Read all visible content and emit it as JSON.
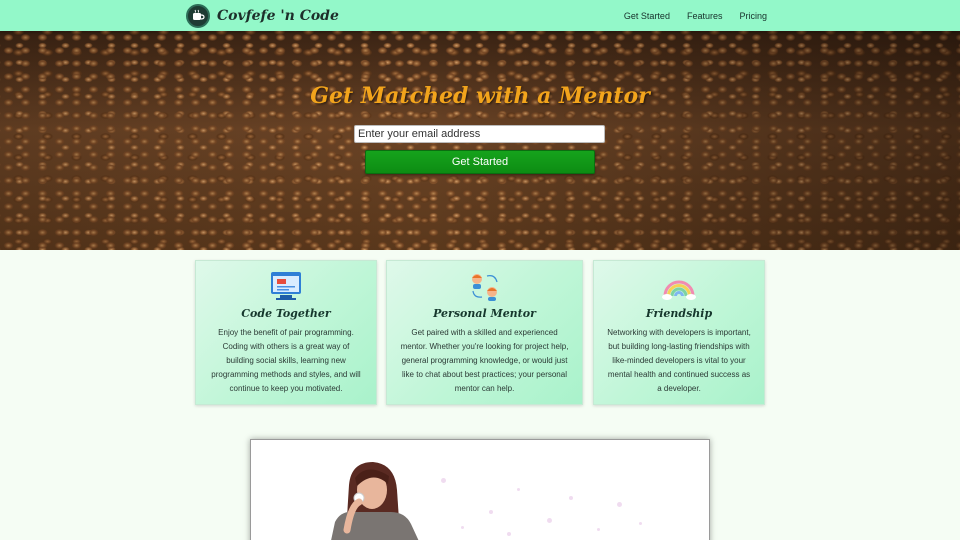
{
  "nav": {
    "brand": {
      "name": "Covfefe 'n Code",
      "logo_icon": "coffee-cup-logo-icon"
    },
    "links": [
      {
        "label": "Get Started"
      },
      {
        "label": "Features"
      },
      {
        "label": "Pricing"
      }
    ]
  },
  "hero": {
    "title": "Get Matched with a Mentor",
    "email_placeholder": "Enter your email address",
    "cta_label": "Get Started"
  },
  "features": [
    {
      "icon": "code-window-icon",
      "title": "Code Together",
      "text": "Enjoy the benefit of pair programming. Coding with others is a great way of building social skills, learning new programming methods and styles, and will continue to keep you motivated."
    },
    {
      "icon": "mentor-exchange-icon",
      "title": "Personal Mentor",
      "text": "Get paired with a skilled and experienced mentor. Whether you're looking for project help, general programming knowledge, or would just like to chat about best practices; your personal mentor can help."
    },
    {
      "icon": "rainbow-icon",
      "title": "Friendship",
      "text": "Networking with developers is important, but building long-lasting friendships with like-minded developers is vital to your mental health and continued success as a developer."
    }
  ],
  "colors": {
    "nav_bg": "#93f8c9",
    "hero_title": "#f2a41c",
    "cta_bg": "#16a31c",
    "page_bg": "#f5fdf4"
  }
}
